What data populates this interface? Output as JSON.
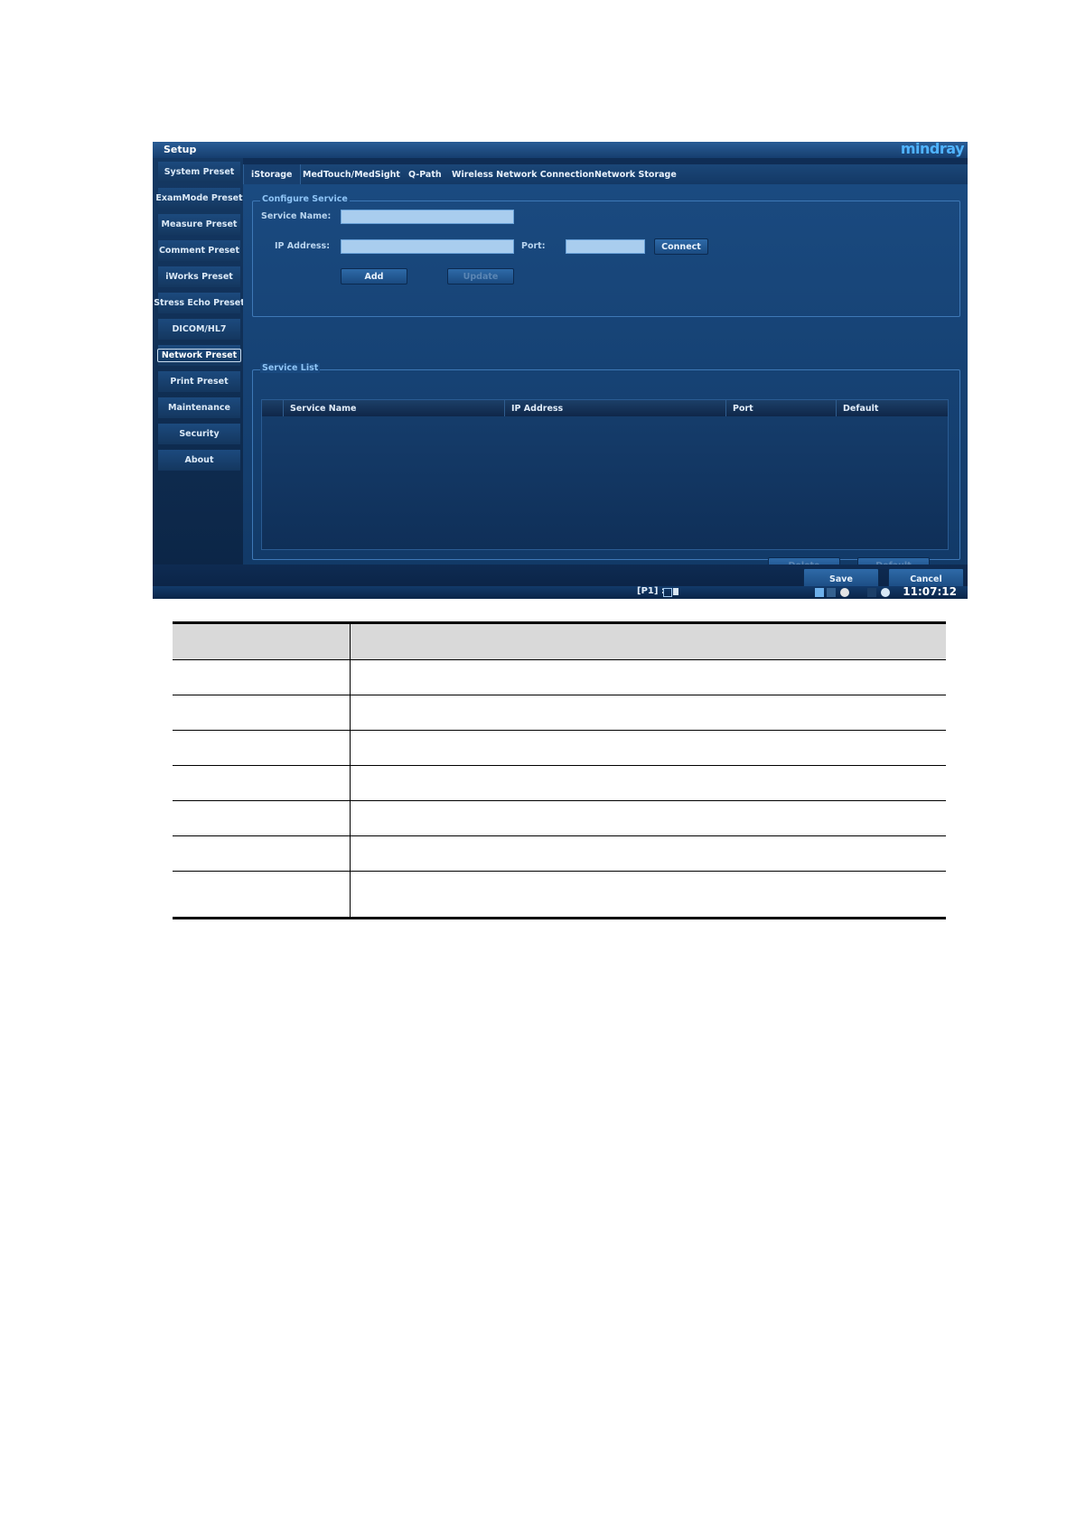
{
  "window": {
    "title": "Setup",
    "brand": "mindray"
  },
  "sidebar": {
    "items": [
      {
        "label": "System Preset"
      },
      {
        "label": "ExamMode Preset"
      },
      {
        "label": "Measure Preset"
      },
      {
        "label": "Comment Preset"
      },
      {
        "label": "iWorks Preset"
      },
      {
        "label": "Stress Echo Preset"
      },
      {
        "label": "DICOM/HL7"
      },
      {
        "label": "Network Preset",
        "active": true
      },
      {
        "label": "Print Preset"
      },
      {
        "label": "Maintenance"
      },
      {
        "label": "Security"
      },
      {
        "label": "About"
      }
    ]
  },
  "tabs": [
    {
      "label": "iStorage",
      "active": true
    },
    {
      "label": "MedTouch/MedSight"
    },
    {
      "label": "Q-Path"
    },
    {
      "label": "Wireless Network Connection"
    },
    {
      "label": "Network Storage"
    }
  ],
  "configure_service": {
    "title": "Configure Service",
    "service_name_label": "Service Name:",
    "service_name_value": "",
    "ip_address_label": "IP Address:",
    "ip_address_value": "",
    "port_label": "Port:",
    "port_value": "",
    "connect_label": "Connect",
    "add_label": "Add",
    "update_label": "Update"
  },
  "service_list": {
    "title": "Service List",
    "columns": [
      "Service Name",
      "IP Address",
      "Port",
      "Default"
    ],
    "rows": [],
    "delete_label": "Delete",
    "default_label": "Default"
  },
  "footer": {
    "save_label": "Save",
    "cancel_label": "Cancel"
  },
  "statusbar": {
    "probe_text": "[P1] :",
    "time": "11:07:12"
  },
  "colors": {
    "window_bg": "#0f2d55",
    "accent": "#4fb3ff",
    "input_bg": "#a9cdee"
  }
}
